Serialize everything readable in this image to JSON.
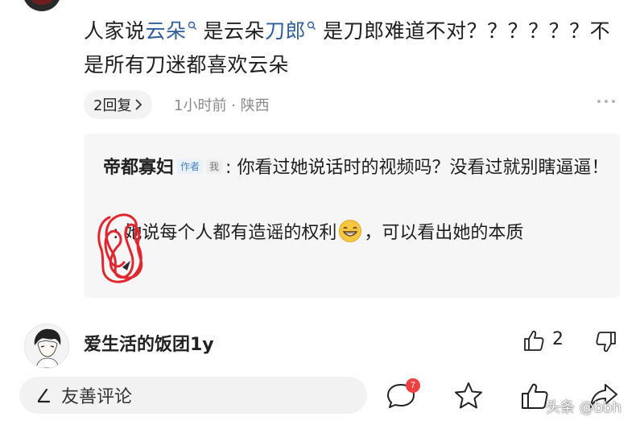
{
  "comment": {
    "part1": "人家说",
    "link1": "云朵",
    "part2": "是云朵",
    "link2": "刀郎",
    "part3": "是刀郎难道不对？？？？？？不是所有刀迷都喜欢云朵",
    "reply_count": "2回复",
    "time": "1小时前",
    "location": "陕西"
  },
  "reply": {
    "author": "帝都寡妇",
    "author_tag": "作者",
    "me_tag": "我",
    "text": ": 你看过她说话时的视频吗？没看过就别瞎逼逼！",
    "line2_prefix": "",
    "line2_hidden_name": "",
    "line2_text": ": 她说每个人都有造谣的权利",
    "line2_text_after": "，可以看出她的本质"
  },
  "comment2": {
    "username": "爱生活的饭团1y",
    "likes": "2"
  },
  "bottom_bar": {
    "input_placeholder": "友善评论",
    "chat_badge": "7"
  },
  "watermark": "头条 @bbh",
  "colors": {
    "link": "#2e5f9c",
    "badge": "#f04142",
    "scribble": "#e0262f"
  }
}
